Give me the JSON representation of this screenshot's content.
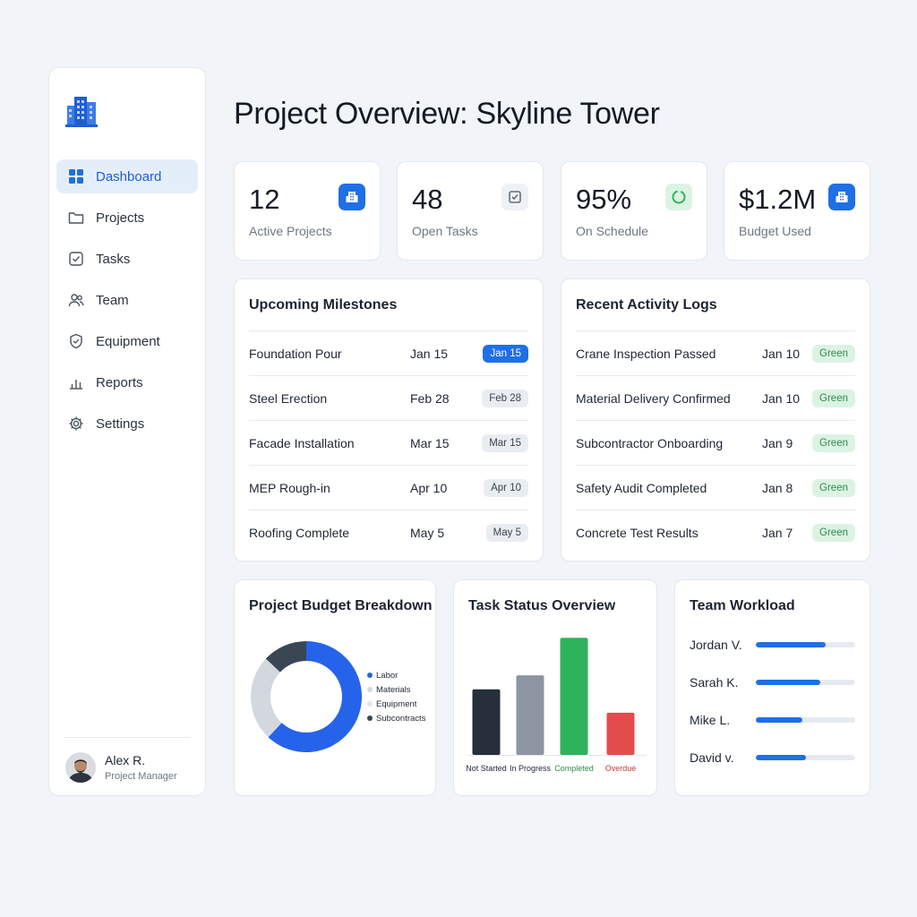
{
  "sidebar": {
    "logo_icon": "building-icon",
    "items": [
      {
        "label": "Dashboard",
        "icon": "grid-icon",
        "active": true
      },
      {
        "label": "Projects",
        "icon": "folder-icon"
      },
      {
        "label": "Tasks",
        "icon": "checkbox-icon"
      },
      {
        "label": "Team",
        "icon": "users-icon"
      },
      {
        "label": "Equipment",
        "icon": "shield-icon"
      },
      {
        "label": "Reports",
        "icon": "bar-chart-icon"
      },
      {
        "label": "Settings",
        "icon": "gear-icon"
      }
    ],
    "profile": {
      "name": "Alex R.",
      "role": "Project Manager"
    }
  },
  "page": {
    "title": "Project Overview: Skyline Tower"
  },
  "kpis": [
    {
      "value": "12",
      "label": "Active Projects",
      "icon": "building-icon",
      "color": "#1f6fe5"
    },
    {
      "value": "48",
      "label": "Open Tasks",
      "icon": "checkbox-icon",
      "color": "#eef1f5"
    },
    {
      "value": "95%",
      "label": "On Schedule",
      "icon": "progress-ring-icon",
      "color": "#dcf3e3"
    },
    {
      "value": "$1.2M",
      "label": "Budget Used",
      "icon": "building-icon",
      "color": "#1f6fe5"
    }
  ],
  "milestones": {
    "title": "Upcoming Milestones",
    "rows": [
      {
        "name": "Foundation Pour",
        "date": "Jan 15",
        "badge": "Jan 15",
        "highlight": true
      },
      {
        "name": "Steel Erection",
        "date": "Feb 28",
        "badge": "Feb 28"
      },
      {
        "name": "Facade Installation",
        "date": "Mar 15",
        "badge": "Mar 15"
      },
      {
        "name": "MEP Rough-in",
        "date": "Apr 10",
        "badge": "Apr 10"
      },
      {
        "name": "Roofing Complete",
        "date": "May 5",
        "badge": "May 5"
      }
    ]
  },
  "activity": {
    "title": "Recent Activity Logs",
    "rows": [
      {
        "name": "Crane Inspection Passed",
        "date": "Jan 10",
        "status": "Green"
      },
      {
        "name": "Material Delivery Confirmed",
        "date": "Jan 10",
        "status": "Green"
      },
      {
        "name": "Subcontractor Onboarding",
        "date": "Jan 9",
        "status": "Green"
      },
      {
        "name": "Safety Audit Completed",
        "date": "Jan 8",
        "status": "Green"
      },
      {
        "name": "Concrete Test Results",
        "date": "Jan 7",
        "status": "Green"
      }
    ]
  },
  "budget": {
    "title": "Project Budget Breakdown"
  },
  "tasks": {
    "title": "Task Status Overview"
  },
  "workload": {
    "title": "Team Workload",
    "members": [
      {
        "name": "Jordan V.",
        "level": 0.7
      },
      {
        "name": "Sarah K.",
        "level": 0.65
      },
      {
        "name": "Mike L.",
        "level": 0.47
      },
      {
        "name": "David v.",
        "level": 0.5
      }
    ]
  },
  "chart_data": [
    {
      "type": "pie",
      "title": "Project Budget Breakdown",
      "donut": true,
      "legend_position": "right",
      "categories": [
        "Labor",
        "Materials",
        "Equipment",
        "Subcontracts"
      ],
      "values": [
        62,
        25,
        0,
        13
      ],
      "colors": [
        "#2563eb",
        "#d3d8df",
        "#e2e6ec",
        "#3b4654"
      ]
    },
    {
      "type": "bar",
      "title": "Task Status Overview",
      "categories": [
        "Not Started",
        "In Progress",
        "Completed",
        "Overdue"
      ],
      "values": [
        14,
        17,
        25,
        9
      ],
      "ylim": [
        0,
        26
      ],
      "grid": false,
      "colors": [
        "#262f3b",
        "#8c95a1",
        "#2fb25c",
        "#e24c4c"
      ],
      "label_colors": [
        "#1f2733",
        "#1f2733",
        "#2f8b4a",
        "#c23a3a"
      ]
    }
  ]
}
